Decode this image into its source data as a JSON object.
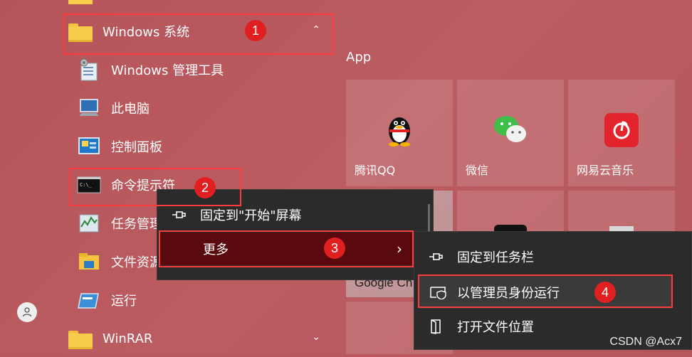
{
  "start_menu": {
    "items": [
      {
        "label": "Windows 系统",
        "expand_icon": "chevron-up-icon"
      },
      {
        "label": "Windows 管理工具"
      },
      {
        "label": "此电脑"
      },
      {
        "label": "控制面板"
      },
      {
        "label": "命令提示符"
      },
      {
        "label": "任务管理"
      },
      {
        "label": "文件资源"
      },
      {
        "label": "运行"
      },
      {
        "label": "WinRAR",
        "expand_icon": "chevron-down-icon"
      }
    ]
  },
  "tiles": {
    "group_title": "App",
    "qq": {
      "label": "腾讯QQ"
    },
    "wechat": {
      "label": "微信"
    },
    "netease": {
      "label": "网易云音乐"
    },
    "chrome": {
      "label": "Google Ch"
    }
  },
  "context_menu": {
    "pin_start": "固定到\"开始\"屏幕",
    "more": "更多"
  },
  "submenu": {
    "pin_taskbar": "固定到任务栏",
    "run_as_admin": "以管理员身份运行",
    "open_location": "打开文件位置"
  },
  "annotations": {
    "step1": "1",
    "step2": "2",
    "step3": "3",
    "step4": "4"
  },
  "watermark": "CSDN @Acx7",
  "colors": {
    "background": "#b8575c",
    "annotation_red": "#ff3b3b",
    "menu_bg": "#2b2b2b",
    "selected_bg": "#5a0a0e"
  }
}
